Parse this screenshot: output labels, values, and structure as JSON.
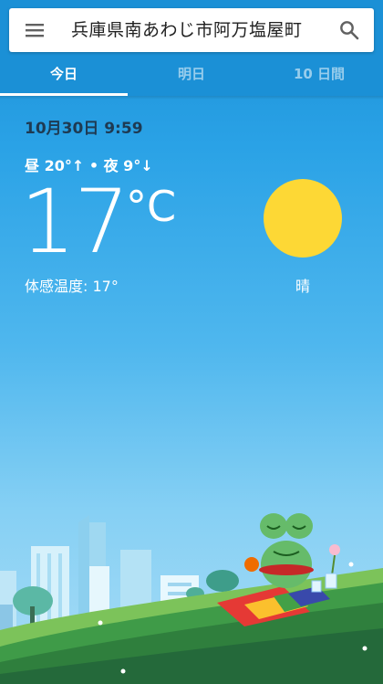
{
  "search": {
    "location": "兵庫県南あわじ市阿万塩屋町"
  },
  "tabs": [
    {
      "label": "今日",
      "active": true
    },
    {
      "label": "明日",
      "active": false
    },
    {
      "label": "10 日間",
      "active": false
    }
  ],
  "weather": {
    "datetime": "10月30日 9:59",
    "hilo": "昼 20°↑ • 夜 9°↓",
    "temperature": "17",
    "unit": "°C",
    "feels_like": "体感温度: 17°",
    "condition": "晴",
    "condition_icon": "sun-icon"
  },
  "colors": {
    "accent": "#1b90d6",
    "sun": "#fdd835"
  }
}
